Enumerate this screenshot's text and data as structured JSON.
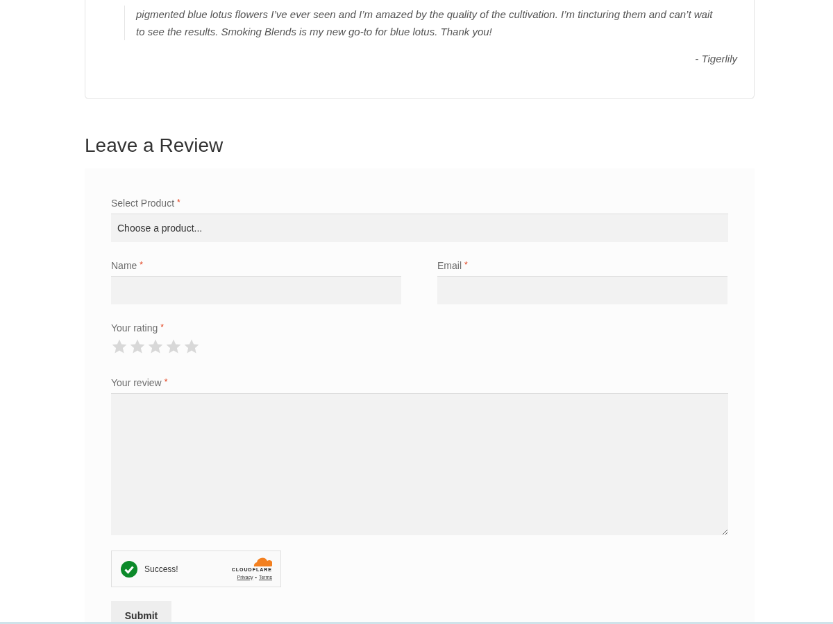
{
  "testimonial": {
    "lines": [
      "pigmented blue lotus flowers I’ve ever seen and I’m amazed by the quality of the cultivation. I’m tincturing them and can’t wait",
      "to see the results. Smoking Blends is my new go-to for blue lotus. Thank you!"
    ],
    "author": "- Tigerlily"
  },
  "review_form": {
    "title": "Leave a Review",
    "product": {
      "label": "Select Product",
      "required_mark": "*",
      "value": "Choose a product..."
    },
    "name": {
      "label": "Name",
      "required_mark": "*"
    },
    "email": {
      "label": "Email",
      "required_mark": "*"
    },
    "rating": {
      "label": "Your rating",
      "required_mark": "*",
      "stars": 0
    },
    "review": {
      "label": "Your review",
      "required_mark": "*"
    },
    "captcha": {
      "status": "Success!",
      "logo": "CLOUDFLARE",
      "links": [
        "Privacy",
        "Terms"
      ],
      "separator": "•"
    },
    "submit": "Submit"
  }
}
